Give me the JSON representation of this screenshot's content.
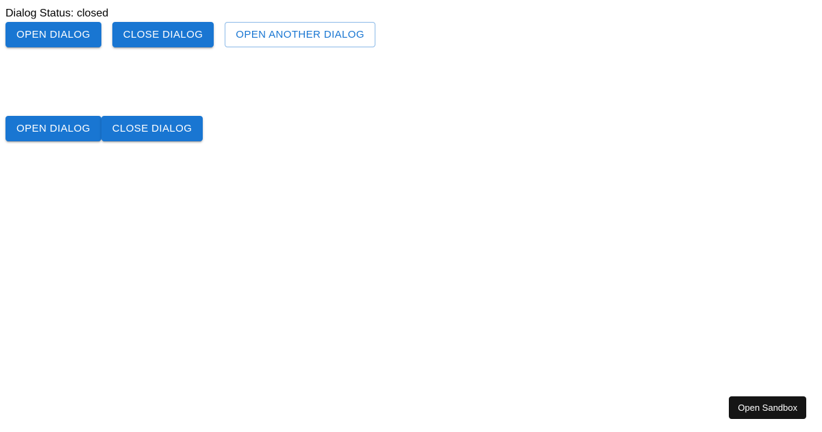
{
  "status": {
    "label": "Dialog Status:",
    "value": "closed"
  },
  "row1": {
    "open_label": "Open Dialog",
    "close_label": "Close Dialog",
    "open_another_label": "Open Another Dialog"
  },
  "row2": {
    "open_label": "Open Dialog",
    "close_label": "Close Dialog"
  },
  "sandbox": {
    "label": "Open Sandbox"
  },
  "colors": {
    "primary": "#1976d2",
    "sandbox_bg": "#151515"
  }
}
